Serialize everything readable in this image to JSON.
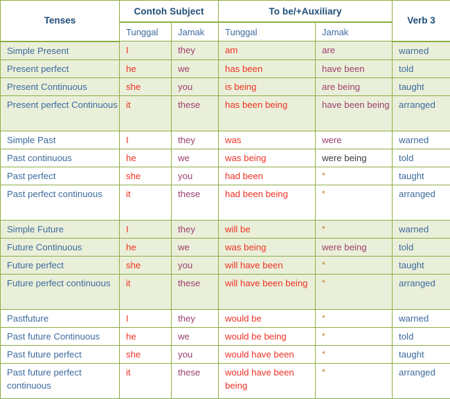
{
  "table": {
    "header": {
      "tenses": "Tenses",
      "contoh_subject": "Contoh Subject",
      "to_be_auxiliary": "To be/+Auxiliary",
      "verb3": "Verb 3",
      "sub_tunggal": "Tunggal",
      "sub_jamak": "Jamak",
      "be_tunggal": "Tunggal",
      "be_jamak": "Jamak"
    },
    "colors": {
      "border": "#8cad45",
      "tint_row_background": "#eaefd9",
      "plain_row_background": "#ffffff",
      "header_text": "#1f4e79",
      "subheader_text": "#3c6b9e",
      "tenses_text": "#3c6b9e",
      "singular_text": "#ee3124",
      "plural_text": "#9c3f6e",
      "verb3_text": "#3c6b9e",
      "asterisk_text": "#c0761b",
      "dark_text": "#3b3b3b"
    },
    "rows": [
      {
        "tense": "Simple Present",
        "subject_tunggal": "I",
        "subject_jamak": "they",
        "be_tunggal": "am",
        "be_jamak": "are",
        "verb3": "warned",
        "shade": "tint",
        "tall": false
      },
      {
        "tense": "Present perfect",
        "subject_tunggal": "he",
        "subject_jamak": "we",
        "be_tunggal": "has been",
        "be_jamak": "have been",
        "verb3": "told",
        "shade": "tint",
        "tall": false
      },
      {
        "tense": "Present Continuous",
        "subject_tunggal": "she",
        "subject_jamak": "you",
        "be_tunggal": "is being",
        "be_jamak": "are being",
        "verb3": "taught",
        "shade": "tint",
        "tall": false
      },
      {
        "tense": "Present perfect Continuous",
        "subject_tunggal": "it",
        "subject_jamak": "these",
        "be_tunggal": "has been being",
        "be_jamak": "have been being",
        "verb3": "arranged",
        "shade": "tint",
        "tall": true
      },
      {
        "tense": "Simple Past",
        "subject_tunggal": "I",
        "subject_jamak": "they",
        "be_tunggal": "was",
        "be_jamak": "were",
        "verb3": "warned",
        "shade": "plain",
        "tall": false
      },
      {
        "tense": "Past continuous",
        "subject_tunggal": "he",
        "subject_jamak": "we",
        "be_tunggal": "was being",
        "be_jamak": "were being",
        "be_jamak_style": "dark",
        "verb3": "told",
        "shade": "plain",
        "tall": false
      },
      {
        "tense": "Past perfect",
        "subject_tunggal": "she",
        "subject_jamak": "you",
        "be_tunggal": "had been",
        "be_jamak": "*",
        "be_jamak_style": "asterisk",
        "verb3": "taught",
        "shade": "plain",
        "tall": false
      },
      {
        "tense": "Past perfect continuous",
        "subject_tunggal": "it",
        "subject_jamak": "these",
        "be_tunggal": "had been being",
        "be_jamak": "*",
        "be_jamak_style": "asterisk",
        "verb3": "arranged",
        "shade": "plain",
        "tall": true
      },
      {
        "tense": "Simple Future",
        "subject_tunggal": "I",
        "subject_jamak": "they",
        "be_tunggal": "will be",
        "be_jamak": "*",
        "be_jamak_style": "asterisk",
        "verb3": "warned",
        "shade": "tint",
        "tall": false
      },
      {
        "tense": "Future Continuous",
        "subject_tunggal": "he",
        "subject_jamak": "we",
        "be_tunggal": "was being",
        "be_jamak": "were being",
        "verb3": "told",
        "shade": "tint",
        "tall": false
      },
      {
        "tense": "Future perfect",
        "subject_tunggal": "she",
        "subject_jamak": "you",
        "be_tunggal": "will have been",
        "be_jamak": "*",
        "be_jamak_style": "asterisk",
        "verb3": "taught",
        "shade": "tint",
        "tall": false
      },
      {
        "tense": "Future perfect continuous",
        "subject_tunggal": "it",
        "subject_jamak": "these",
        "be_tunggal": "will have been being",
        "be_jamak": "*",
        "be_jamak_style": "asterisk",
        "verb3": "arranged",
        "shade": "tint",
        "tall": true
      },
      {
        "tense": "Pastfuture",
        "subject_tunggal": "I",
        "subject_jamak": "they",
        "be_tunggal": "would be",
        "be_jamak": "*",
        "be_jamak_style": "asterisk",
        "verb3": "warned",
        "shade": "plain",
        "tall": false
      },
      {
        "tense": "Past future Continuous",
        "subject_tunggal": "he",
        "subject_jamak": "we",
        "be_tunggal": "would be being",
        "be_jamak": "*",
        "be_jamak_style": "asterisk",
        "verb3": "told",
        "shade": "plain",
        "tall": false
      },
      {
        "tense": "Past future perfect",
        "subject_tunggal": "she",
        "subject_jamak": "you",
        "be_tunggal": "would have been",
        "be_jamak": "*",
        "be_jamak_style": "asterisk",
        "verb3": "taught",
        "shade": "plain",
        "tall": false
      },
      {
        "tense": "Past future perfect continuous",
        "subject_tunggal": "it",
        "subject_jamak": "these",
        "be_tunggal": "would have been being",
        "be_jamak": "*",
        "be_jamak_style": "asterisk",
        "verb3": "arranged",
        "shade": "plain",
        "tall": true
      }
    ]
  }
}
